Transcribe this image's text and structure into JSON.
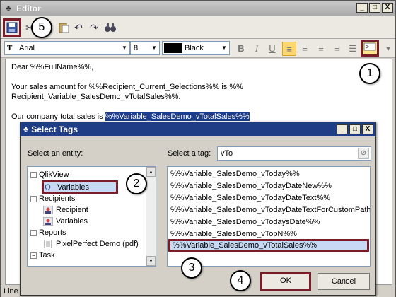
{
  "window": {
    "title": "Editor",
    "minimize": "_",
    "maximize": "□",
    "close": "X"
  },
  "toolbar": {
    "save_icon": "save-icon",
    "cut_icon": "cut-icon",
    "paste_icon": "paste-icon",
    "undo_icon": "undo-icon",
    "redo_icon": "redo-icon",
    "find_icon": "binoculars-icon"
  },
  "format_toolbar": {
    "font": "Arial",
    "font_icon": "T",
    "size": "8",
    "color_name": "Black",
    "color_value": "#000000",
    "bold": "B",
    "italic": "I",
    "underline": "U"
  },
  "editor": {
    "line1": "Dear %%FullName%%,",
    "line2a": "Your sales amount for %%Recipient_Current_Selections%% is %%",
    "line2b": "Recipient_Variable_SalesDemo_vTotalSales%%.",
    "line3_prefix": "Our company total sales is ",
    "line3_selected": "%%Variable_SalesDemo_vTotalSales%%"
  },
  "status": {
    "text": "Line"
  },
  "dialog": {
    "title": "Select Tags",
    "entity_label": "Select an entity:",
    "tag_label": "Select a tag:",
    "tag_filter": "vTo",
    "tree": [
      {
        "label": "QlikView",
        "expander": "−"
      },
      {
        "label": "Variables"
      },
      {
        "label": "Recipients",
        "expander": "−"
      },
      {
        "label": "Recipient"
      },
      {
        "label": "Variables"
      },
      {
        "label": "Reports",
        "expander": "−"
      },
      {
        "label": "PixelPerfect Demo (pdf)"
      },
      {
        "label": "Task",
        "expander": "−"
      }
    ],
    "tags": [
      "%%Variable_SalesDemo_vToday%%",
      "%%Variable_SalesDemo_vTodayDateNew%%",
      "%%Variable_SalesDemo_vTodayDateText%%",
      "%%Variable_SalesDemo_vTodayDateTextForCustomPath",
      "%%Variable_SalesDemo_vTodaysDate%%",
      "%%Variable_SalesDemo_vTopN%%",
      "%%Variable_SalesDemo_vTotalSales%%"
    ],
    "ok": "OK",
    "cancel": "Cancel"
  },
  "callouts": [
    "1",
    "2",
    "3",
    "4",
    "5"
  ],
  "colors": {
    "highlight": "#7a1c2a",
    "selection": "#1c3c8c",
    "dialog_title": "#1f3c86"
  }
}
